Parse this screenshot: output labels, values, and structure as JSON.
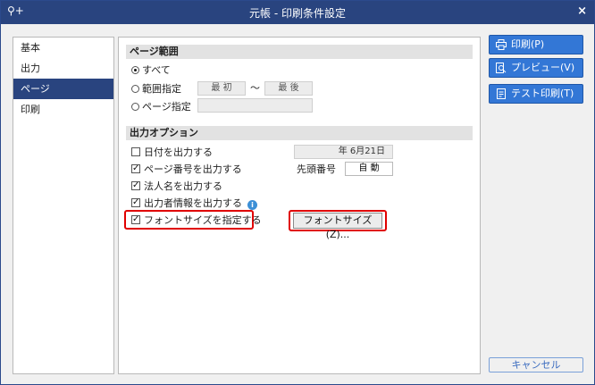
{
  "window": {
    "title": "元帳 - 印刷条件設定",
    "left_icon": "⚲+",
    "close_glyph": "×"
  },
  "sidebar": {
    "items": [
      {
        "label": "基本",
        "active": false
      },
      {
        "label": "出力",
        "active": false
      },
      {
        "label": "ページ",
        "active": true
      },
      {
        "label": "印刷",
        "active": false
      }
    ]
  },
  "page_range": {
    "header": "ページ範囲",
    "all_label": "すべて",
    "range_label": "範囲指定",
    "range_from": "最 初",
    "range_sep": "〜",
    "range_to": "最 後",
    "page_spec_label": "ページ指定",
    "page_spec_value": "",
    "selected": "all"
  },
  "output_options": {
    "header": "出力オプション",
    "date_label": "日付を出力する",
    "date_value": "年  6月21日",
    "page_number_label": "ページ番号を出力する",
    "start_number_label": "先頭番号",
    "start_number_value": "自 動",
    "corp_name_label": "法人名を出力する",
    "outputter_label": "出力者情報を出力する",
    "info_glyph": "i",
    "font_size_label": "フォントサイズを指定する",
    "font_size_button": "フォントサイズ(Z)...",
    "checked": {
      "date": false,
      "page_number": true,
      "corp_name": true,
      "outputter": true,
      "font_size": true
    }
  },
  "actions": {
    "print": "印刷(P)",
    "preview": "プレビュー(V)",
    "test_print": "テスト印刷(T)",
    "cancel": "キャンセル"
  },
  "colors": {
    "titlebar": "#29447f",
    "accent_button": "#3377d6",
    "highlight": "#e00000"
  }
}
